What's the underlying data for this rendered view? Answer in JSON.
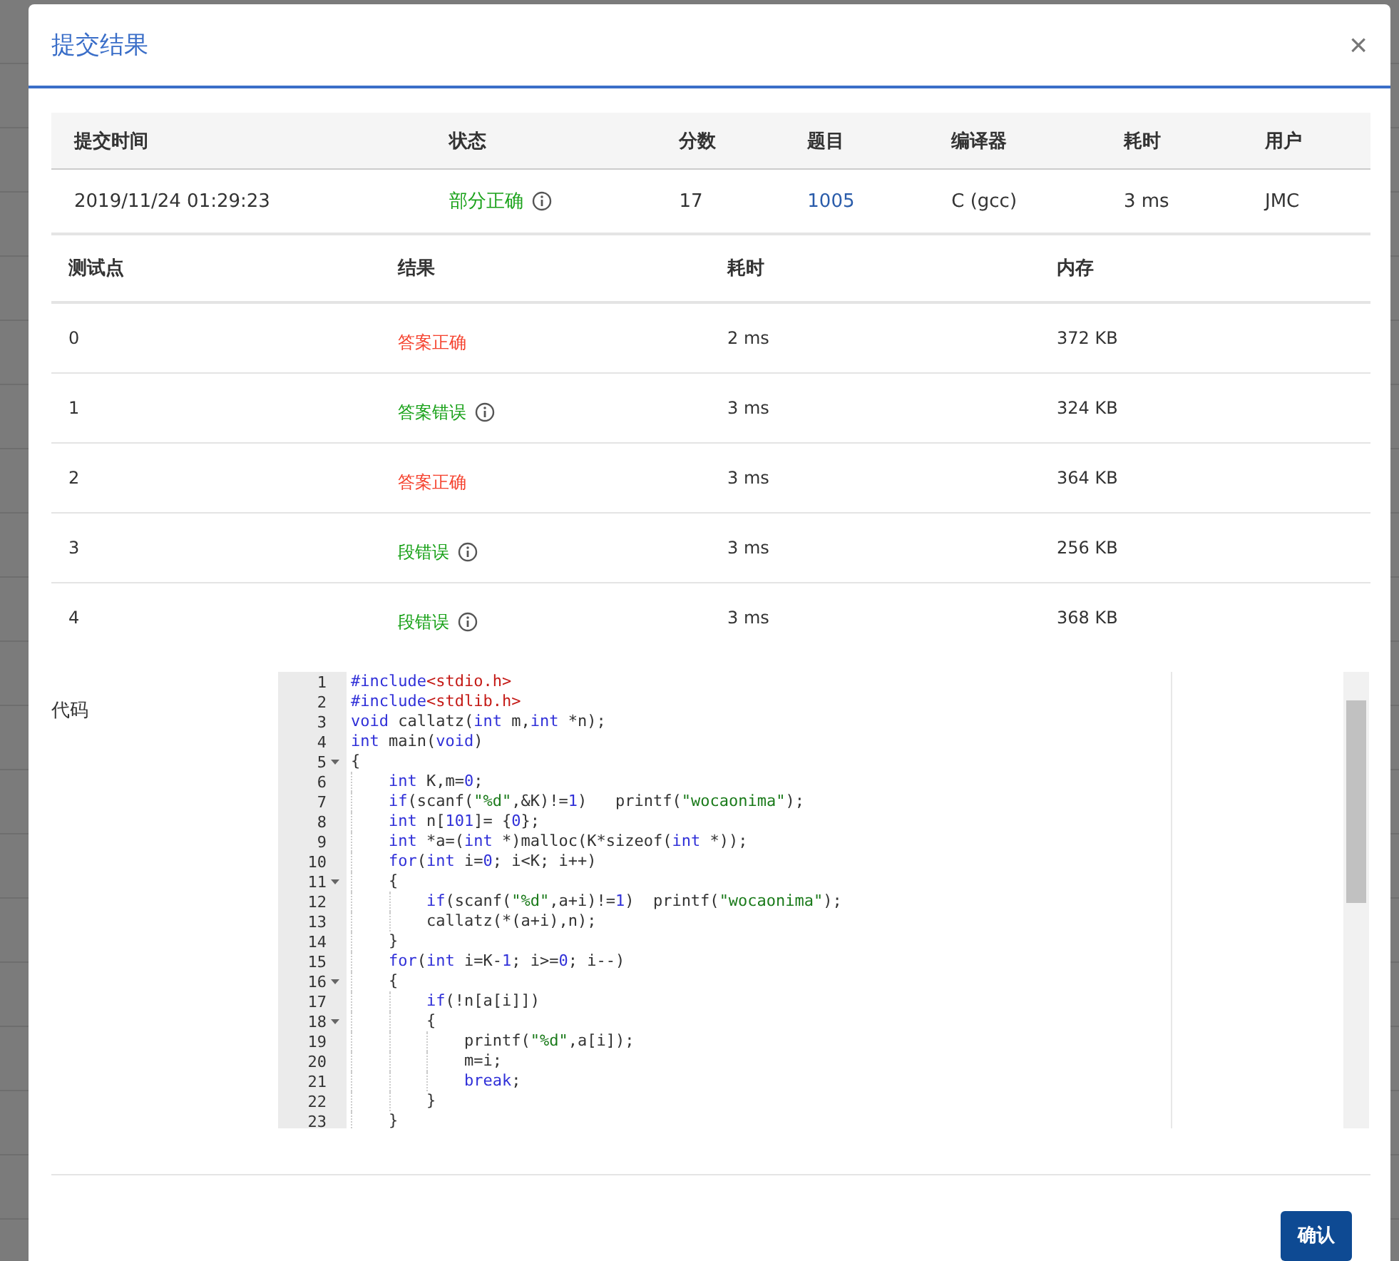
{
  "dialog": {
    "title": "提交结果",
    "close": "×"
  },
  "submission": {
    "columns": [
      "提交时间",
      "状态",
      "分数",
      "题目",
      "编译器",
      "耗时",
      "用户"
    ],
    "row": {
      "time": "2019/11/24 01:29:23",
      "status": "部分正确",
      "color": "#1aa21a",
      "info": true,
      "score": "17",
      "problem": "1005",
      "compiler": "C (gcc)",
      "elapsed": "3 ms",
      "user": "JMC"
    }
  },
  "tests": {
    "columns": [
      "测试点",
      "结果",
      "耗时",
      "内存"
    ],
    "rows": [
      {
        "case": "0",
        "result": "答案正确",
        "color": "#f5412d",
        "info": false,
        "time": "2 ms",
        "memory": "372 KB"
      },
      {
        "case": "1",
        "result": "答案错误",
        "color": "#1aa21a",
        "info": true,
        "time": "3 ms",
        "memory": "324 KB"
      },
      {
        "case": "2",
        "result": "答案正确",
        "color": "#f5412d",
        "info": false,
        "time": "3 ms",
        "memory": "364 KB"
      },
      {
        "case": "3",
        "result": "段错误",
        "color": "#1aa21a",
        "info": true,
        "time": "3 ms",
        "memory": "256 KB"
      },
      {
        "case": "4",
        "result": "段错误",
        "color": "#1aa21a",
        "info": true,
        "time": "3 ms",
        "memory": "368 KB"
      }
    ]
  },
  "code": {
    "label": "代码",
    "lines": [
      {
        "n": "1",
        "fold": false,
        "tokens": [
          {
            "kind": "keyword",
            "text": "#include"
          },
          {
            "kind": "header",
            "text": "<stdio.h>"
          }
        ]
      },
      {
        "n": "2",
        "fold": false,
        "tokens": [
          {
            "kind": "keyword",
            "text": "#include"
          },
          {
            "kind": "header",
            "text": "<stdlib.h>"
          }
        ]
      },
      {
        "n": "3",
        "fold": false,
        "tokens": [
          {
            "kind": "keyword",
            "text": "void"
          },
          {
            "kind": "plain",
            "text": " callatz("
          },
          {
            "kind": "keyword",
            "text": "int"
          },
          {
            "kind": "plain",
            "text": " m,"
          },
          {
            "kind": "keyword",
            "text": "int"
          },
          {
            "kind": "plain",
            "text": " *n);"
          }
        ]
      },
      {
        "n": "4",
        "fold": false,
        "tokens": [
          {
            "kind": "keyword",
            "text": "int"
          },
          {
            "kind": "plain",
            "text": " main("
          },
          {
            "kind": "keyword",
            "text": "void"
          },
          {
            "kind": "plain",
            "text": ")"
          }
        ]
      },
      {
        "n": "5",
        "fold": true,
        "tokens": [
          {
            "kind": "plain",
            "text": "{"
          }
        ]
      },
      {
        "n": "6",
        "fold": false,
        "tokens": [
          {
            "kind": "keyword",
            "text": "    int"
          },
          {
            "kind": "plain",
            "text": " K,m="
          },
          {
            "kind": "number",
            "text": "0"
          },
          {
            "kind": "plain",
            "text": ";"
          }
        ]
      },
      {
        "n": "7",
        "fold": false,
        "tokens": [
          {
            "kind": "keyword",
            "text": "    if"
          },
          {
            "kind": "plain",
            "text": "(scanf("
          },
          {
            "kind": "string",
            "text": "\"%d\""
          },
          {
            "kind": "plain",
            "text": ",&K)!="
          },
          {
            "kind": "number",
            "text": "1"
          },
          {
            "kind": "plain",
            "text": ")   printf("
          },
          {
            "kind": "string",
            "text": "\"wocaonima\""
          },
          {
            "kind": "plain",
            "text": ");"
          }
        ]
      },
      {
        "n": "8",
        "fold": false,
        "tokens": [
          {
            "kind": "keyword",
            "text": "    int"
          },
          {
            "kind": "plain",
            "text": " n["
          },
          {
            "kind": "number",
            "text": "101"
          },
          {
            "kind": "plain",
            "text": "]= {"
          },
          {
            "kind": "number",
            "text": "0"
          },
          {
            "kind": "plain",
            "text": "};"
          }
        ]
      },
      {
        "n": "9",
        "fold": false,
        "tokens": [
          {
            "kind": "keyword",
            "text": "    int"
          },
          {
            "kind": "plain",
            "text": " *a=("
          },
          {
            "kind": "keyword",
            "text": "int"
          },
          {
            "kind": "plain",
            "text": " *)malloc(K*sizeof("
          },
          {
            "kind": "keyword",
            "text": "int"
          },
          {
            "kind": "plain",
            "text": " *));"
          }
        ]
      },
      {
        "n": "10",
        "fold": false,
        "tokens": [
          {
            "kind": "keyword",
            "text": "    for"
          },
          {
            "kind": "plain",
            "text": "("
          },
          {
            "kind": "keyword",
            "text": "int"
          },
          {
            "kind": "plain",
            "text": " i="
          },
          {
            "kind": "number",
            "text": "0"
          },
          {
            "kind": "plain",
            "text": "; i<K; i++)"
          }
        ]
      },
      {
        "n": "11",
        "fold": true,
        "tokens": [
          {
            "kind": "plain",
            "text": "    {"
          }
        ]
      },
      {
        "n": "12",
        "fold": false,
        "tokens": [
          {
            "kind": "keyword",
            "text": "        if"
          },
          {
            "kind": "plain",
            "text": "(scanf("
          },
          {
            "kind": "string",
            "text": "\"%d\""
          },
          {
            "kind": "plain",
            "text": ",a+i)!="
          },
          {
            "kind": "number",
            "text": "1"
          },
          {
            "kind": "plain",
            "text": ")  printf("
          },
          {
            "kind": "string",
            "text": "\"wocaonima\""
          },
          {
            "kind": "plain",
            "text": ");"
          }
        ]
      },
      {
        "n": "13",
        "fold": false,
        "tokens": [
          {
            "kind": "plain",
            "text": "        callatz(*(a+i),n);"
          }
        ]
      },
      {
        "n": "14",
        "fold": false,
        "tokens": [
          {
            "kind": "plain",
            "text": "    }"
          }
        ]
      },
      {
        "n": "15",
        "fold": false,
        "tokens": [
          {
            "kind": "keyword",
            "text": "    for"
          },
          {
            "kind": "plain",
            "text": "("
          },
          {
            "kind": "keyword",
            "text": "int"
          },
          {
            "kind": "plain",
            "text": " i=K-"
          },
          {
            "kind": "number",
            "text": "1"
          },
          {
            "kind": "plain",
            "text": "; i>="
          },
          {
            "kind": "number",
            "text": "0"
          },
          {
            "kind": "plain",
            "text": "; i--)"
          }
        ]
      },
      {
        "n": "16",
        "fold": true,
        "tokens": [
          {
            "kind": "plain",
            "text": "    {"
          }
        ]
      },
      {
        "n": "17",
        "fold": false,
        "tokens": [
          {
            "kind": "keyword",
            "text": "        if"
          },
          {
            "kind": "plain",
            "text": "(!n[a[i]])"
          }
        ]
      },
      {
        "n": "18",
        "fold": true,
        "tokens": [
          {
            "kind": "plain",
            "text": "        {"
          }
        ]
      },
      {
        "n": "19",
        "fold": false,
        "tokens": [
          {
            "kind": "plain",
            "text": "            printf("
          },
          {
            "kind": "string",
            "text": "\"%d\""
          },
          {
            "kind": "plain",
            "text": ",a[i]);"
          }
        ]
      },
      {
        "n": "20",
        "fold": false,
        "tokens": [
          {
            "kind": "plain",
            "text": "            m=i;"
          }
        ]
      },
      {
        "n": "21",
        "fold": false,
        "tokens": [
          {
            "kind": "keyword",
            "text": "            break"
          },
          {
            "kind": "plain",
            "text": ";"
          }
        ]
      },
      {
        "n": "22",
        "fold": false,
        "tokens": [
          {
            "kind": "plain",
            "text": "        }"
          }
        ]
      },
      {
        "n": "23",
        "fold": false,
        "tokens": [
          {
            "kind": "plain",
            "text": "    }"
          }
        ]
      }
    ]
  },
  "confirm_button": "确认"
}
